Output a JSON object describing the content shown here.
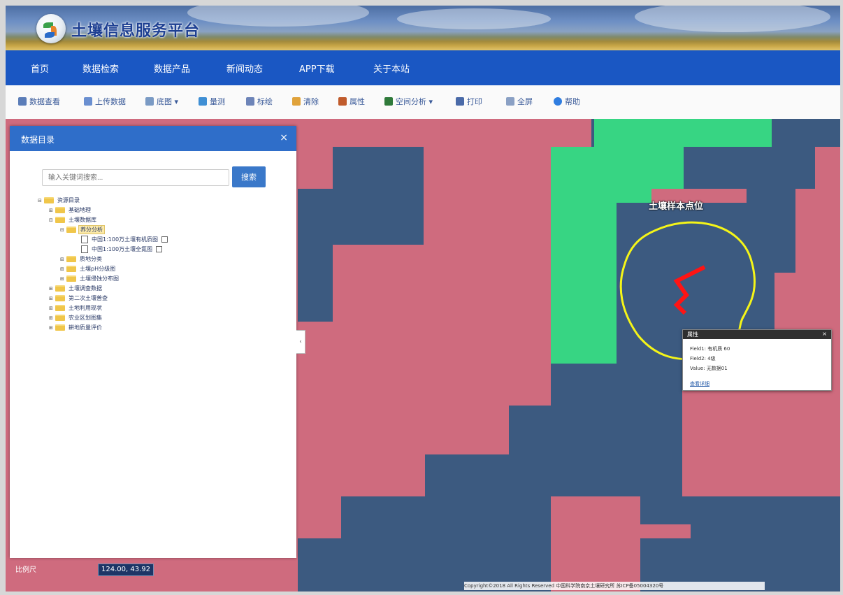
{
  "site": {
    "title": "土壤信息服务平台"
  },
  "nav": {
    "items": [
      {
        "label": "首页"
      },
      {
        "label": "数据检索"
      },
      {
        "label": "数据产品"
      },
      {
        "label": "新闻动态"
      },
      {
        "label": "APP下载"
      },
      {
        "label": "关于本站"
      }
    ]
  },
  "toolbar": {
    "items": [
      {
        "label": "数据查看",
        "icon": "magnifier-icon",
        "color": "#5b7db8"
      },
      {
        "label": "上传数据",
        "icon": "upload-icon",
        "color": "#6a8fd0"
      },
      {
        "label": "底图 ▾",
        "icon": "basemap-icon",
        "color": "#7a9ac4"
      },
      {
        "label": "量测",
        "icon": "ruler-icon",
        "color": "#3f8fd4"
      },
      {
        "label": "标绘",
        "icon": "pen-icon",
        "color": "#6d84b8"
      },
      {
        "label": "清除",
        "icon": "eraser-icon",
        "color": "#e0a23a"
      },
      {
        "label": "属性",
        "icon": "chart-icon",
        "color": "#c05b2c"
      },
      {
        "label": "空间分析 ▾",
        "icon": "analysis-icon",
        "color": "#2f7a3a"
      },
      {
        "label": "打印",
        "icon": "print-icon",
        "color": "#4a6aa8"
      },
      {
        "label": "全屏",
        "icon": "fullscreen-icon",
        "color": "#8aa0c4"
      },
      {
        "label": "帮助",
        "icon": "help-icon",
        "color": "#2f7de0"
      }
    ]
  },
  "panel": {
    "title": "数据目录",
    "close": "×",
    "search": {
      "placeholder": "输入关键词搜索...",
      "button": "搜索"
    },
    "tree": [
      {
        "label": "资源目录",
        "toggle": "⊟",
        "type": "folder"
      },
      {
        "label": "基础地理",
        "toggle": "⊞",
        "type": "folder"
      },
      {
        "label": "土壤数据库",
        "toggle": "⊟",
        "type": "folder"
      },
      {
        "label": "养分分析",
        "toggle": "⊟",
        "type": "folder",
        "selected": true
      },
      {
        "label": "中国1:100万土壤有机质图",
        "toggle": "",
        "type": "file"
      },
      {
        "label": "中国1:100万土壤全氮图",
        "toggle": "",
        "type": "file"
      },
      {
        "label": "质地分类",
        "toggle": "⊞",
        "type": "folder"
      },
      {
        "label": "土壤pH分级图",
        "toggle": "⊞",
        "type": "folder"
      },
      {
        "label": "土壤侵蚀分布图",
        "toggle": "⊞",
        "type": "folder"
      },
      {
        "label": "土壤调查数据",
        "toggle": "⊞",
        "type": "folder"
      },
      {
        "label": "第二次土壤普查",
        "toggle": "⊞",
        "type": "folder"
      },
      {
        "label": "土地利用现状",
        "toggle": "⊞",
        "type": "folder"
      },
      {
        "label": "农业区划图集",
        "toggle": "⊞",
        "type": "folder"
      },
      {
        "label": "耕地质量评价",
        "toggle": "⊞",
        "type": "folder"
      }
    ]
  },
  "map": {
    "label": "土壤样本点位",
    "scale": "比例尺",
    "coordinates": "124.00, 43.92",
    "copyright": "Copyright©2018 All Rights Reserved 中国科学院南京土壤研究所 苏ICP备05004320号",
    "colors": {
      "pink": "#cf6b7e",
      "blue": "#3c5a80",
      "green": "#37d583",
      "outline": "#f5f518",
      "line": "#ff1414"
    }
  },
  "popup": {
    "title": "属性",
    "close": "×",
    "rows": [
      "Field1: 有机质 60",
      "Field2: 4级",
      "Value: 无数据01"
    ],
    "link": "查看详细"
  }
}
